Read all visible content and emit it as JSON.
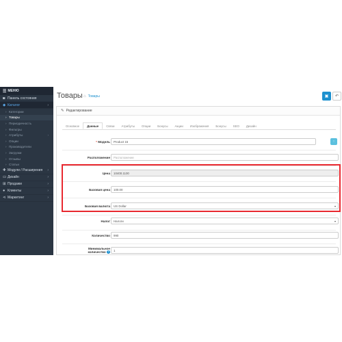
{
  "sidebar": {
    "menu_label": "МЕНЮ",
    "items": [
      {
        "label": "Панель состояния",
        "icon": "dashboard-icon",
        "has_chevron": false,
        "active": false
      },
      {
        "label": "Каталог",
        "icon": "tag-icon",
        "has_chevron": true,
        "active": true
      }
    ],
    "subitems": [
      {
        "label": "Категории",
        "chevron": false,
        "active": false
      },
      {
        "label": "Товары",
        "chevron": false,
        "active": true
      },
      {
        "label": "Периодичность",
        "chevron": false,
        "active": false
      },
      {
        "label": "Фильтры",
        "chevron": false,
        "active": false
      },
      {
        "label": "Атрибуты",
        "chevron": true,
        "active": false
      },
      {
        "label": "Опции",
        "chevron": false,
        "active": false
      },
      {
        "label": "Производители",
        "chevron": false,
        "active": false
      },
      {
        "label": "Загрузки",
        "chevron": false,
        "active": false
      },
      {
        "label": "Отзывы",
        "chevron": false,
        "active": false
      },
      {
        "label": "Статьи",
        "chevron": false,
        "active": false
      }
    ],
    "bottom_items": [
      {
        "label": "Модули / Расширения",
        "icon": "puzzle-icon"
      },
      {
        "label": "Дизайн",
        "icon": "monitor-icon"
      },
      {
        "label": "Продажи",
        "icon": "cart-icon"
      },
      {
        "label": "Клиенты",
        "icon": "user-icon"
      },
      {
        "label": "Маркетинг",
        "icon": "share-icon"
      }
    ]
  },
  "header": {
    "title": "Товары",
    "breadcrumb": "Товары"
  },
  "panel": {
    "title": "Редактирование"
  },
  "tabs": [
    "Основное",
    "Данные",
    "Связи",
    "Атрибуты",
    "Опции",
    "Бонусы",
    "Акции",
    "Изображения",
    "Бонусы",
    "SEO",
    "Дизайн"
  ],
  "active_tab": 1,
  "form": {
    "model": {
      "label": "Модель",
      "value": "Product 15"
    },
    "location": {
      "label": "Расположение",
      "placeholder": "Расположение"
    },
    "price": {
      "label": "Цена",
      "value": "10400.1100"
    },
    "base_price": {
      "label": "Базовая цена",
      "value": "100.00"
    },
    "base_currency": {
      "label": "Базовая валюта",
      "value": "US Dollar"
    },
    "tax": {
      "label": "Налог",
      "value": "Налоги"
    },
    "quantity": {
      "label": "Количество",
      "value": "990"
    },
    "min_quantity": {
      "label_line1": "Минимальное",
      "label_line2": "количество",
      "value": "1"
    }
  },
  "colors": {
    "sidebar_bg": "#2b3643",
    "accent": "#1e91cf",
    "highlight": "#e8272e",
    "required": "#e3503e"
  }
}
